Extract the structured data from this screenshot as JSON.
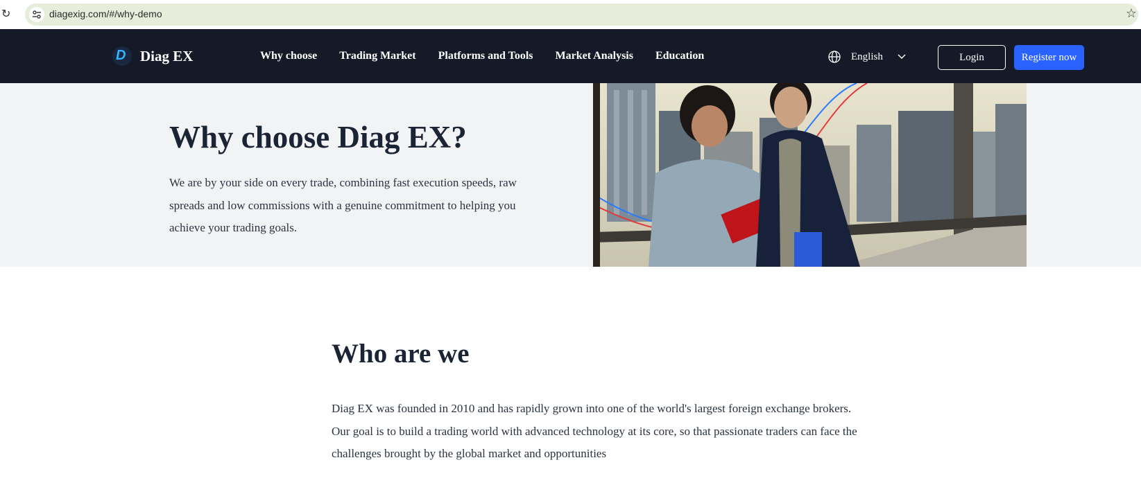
{
  "browser": {
    "url": "diagexig.com/#/why-demo"
  },
  "nav": {
    "brand": "Diag EX",
    "brand_mark": "D",
    "links": [
      "Why choose",
      "Trading Market",
      "Platforms and Tools",
      "Market Analysis",
      "Education"
    ],
    "language": "English",
    "login_label": "Login",
    "register_label": "Register now"
  },
  "hero": {
    "title": "Why choose Diag EX?",
    "description": "We are by your side on every trade, combining fast execution speeds, raw spreads and low commissions with a genuine commitment to helping you achieve your trading goals."
  },
  "who": {
    "title": "Who are we",
    "description": "Diag EX was founded in 2010 and has rapidly grown into one of the world's largest foreign exchange brokers. Our goal is to build a trading world with advanced technology at its core, so that passionate traders can face the challenges brought by the global market and opportunities"
  },
  "colors": {
    "nav_bg": "#141a27",
    "accent": "#2962ff",
    "hero_bg": "#f2f3f5",
    "omnibox_bg": "#e6eedb"
  },
  "icons": {
    "reload": "reload-icon",
    "site_info": "site-info-icon",
    "bookmark": "bookmark-star-icon",
    "globe": "globe-icon",
    "chevron": "chevron-down-icon"
  }
}
